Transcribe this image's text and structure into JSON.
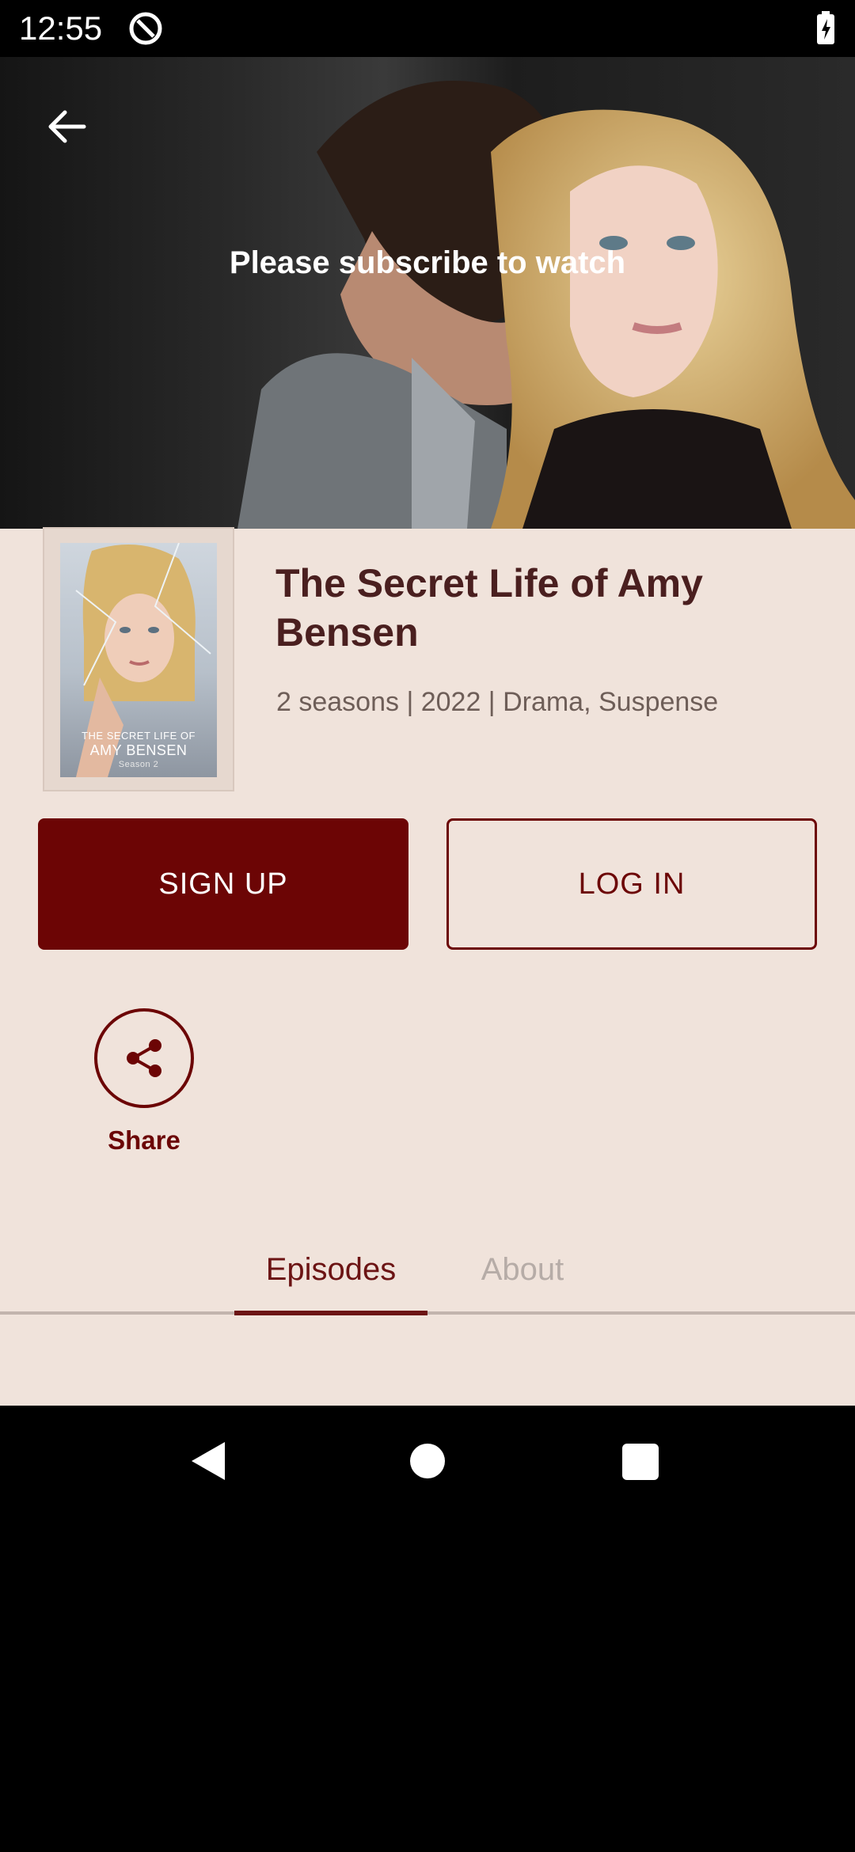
{
  "status_bar": {
    "time": "12:55"
  },
  "hero": {
    "message": "Please subscribe to watch"
  },
  "show": {
    "title": "The Secret Life of Amy Bensen",
    "meta": "2 seasons | 2022 | Drama, Suspense",
    "poster": {
      "line1": "THE SECRET LIFE OF",
      "line2": "AMY BENSEN",
      "line3": "Season 2"
    }
  },
  "actions": {
    "signup_label": "SIGN UP",
    "login_label": "LOG IN",
    "share_label": "Share"
  },
  "tabs": [
    {
      "label": "Episodes",
      "selected": true
    },
    {
      "label": "About",
      "selected": false
    }
  ],
  "colors": {
    "accent": "#6c0505",
    "background": "#f0e3db"
  }
}
